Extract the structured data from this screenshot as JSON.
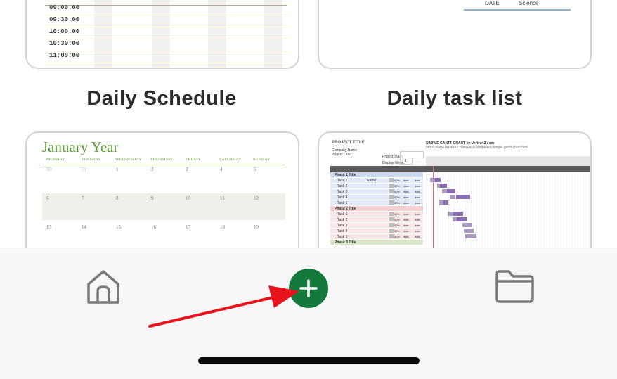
{
  "templates": [
    {
      "title": "Daily Schedule",
      "times": [
        "09:00:00",
        "09:30:00",
        "10:00:00",
        "10:30:00",
        "11:00:00"
      ]
    },
    {
      "title": "Daily task list",
      "columns": [
        "DATE",
        "Science"
      ]
    },
    {
      "month_title": "January Year",
      "weekdays": [
        "MONDAY",
        "TUESDAY",
        "WEDNESDAY",
        "THURSDAY",
        "FRIDAY",
        "SATURDAY",
        "SUNDAY"
      ],
      "weeks": [
        [
          "30",
          "31",
          "1",
          "2",
          "3",
          "4",
          "5"
        ],
        [
          "6",
          "7",
          "8",
          "9",
          "10",
          "11",
          "12"
        ],
        [
          "13",
          "14",
          "15",
          "16",
          "17",
          "18",
          "19"
        ]
      ]
    },
    {
      "project_title": "PROJECT TITLE",
      "meta": [
        "Company Name",
        "Project Lead"
      ],
      "project_start_label": "Project Start:",
      "display_week_label": "Display Week:",
      "display_week_value": "1",
      "header_title": "SIMPLE GANTT CHART by Vertex42.com",
      "header_url": "https://www.vertex42.com/ExcelTemplates/simple-gantt-chart.html",
      "phases": [
        {
          "name": "Phase 1 Title",
          "color": "#c9d8ee",
          "tasks": [
            "Task 1",
            "Task 2",
            "Task 3",
            "Task 4",
            "Task 5"
          ]
        },
        {
          "name": "Phase 2 Title",
          "color": "#f3cfcf",
          "tasks": [
            "Task 1",
            "Task 2",
            "Task 3",
            "Task 4",
            "Task 5"
          ]
        },
        {
          "name": "Phase 3 Title",
          "color": "#d9e8c8",
          "tasks": []
        }
      ],
      "first_task_assignee": "Name",
      "progress_value": "50%",
      "date_value": "date"
    }
  ],
  "bottom_nav": {
    "home_icon": "home-icon",
    "add_icon": "plus-icon",
    "folder_icon": "folder-icon"
  },
  "colors": {
    "accent_green": "#137a3c",
    "arrow_red": "#e8141c"
  }
}
